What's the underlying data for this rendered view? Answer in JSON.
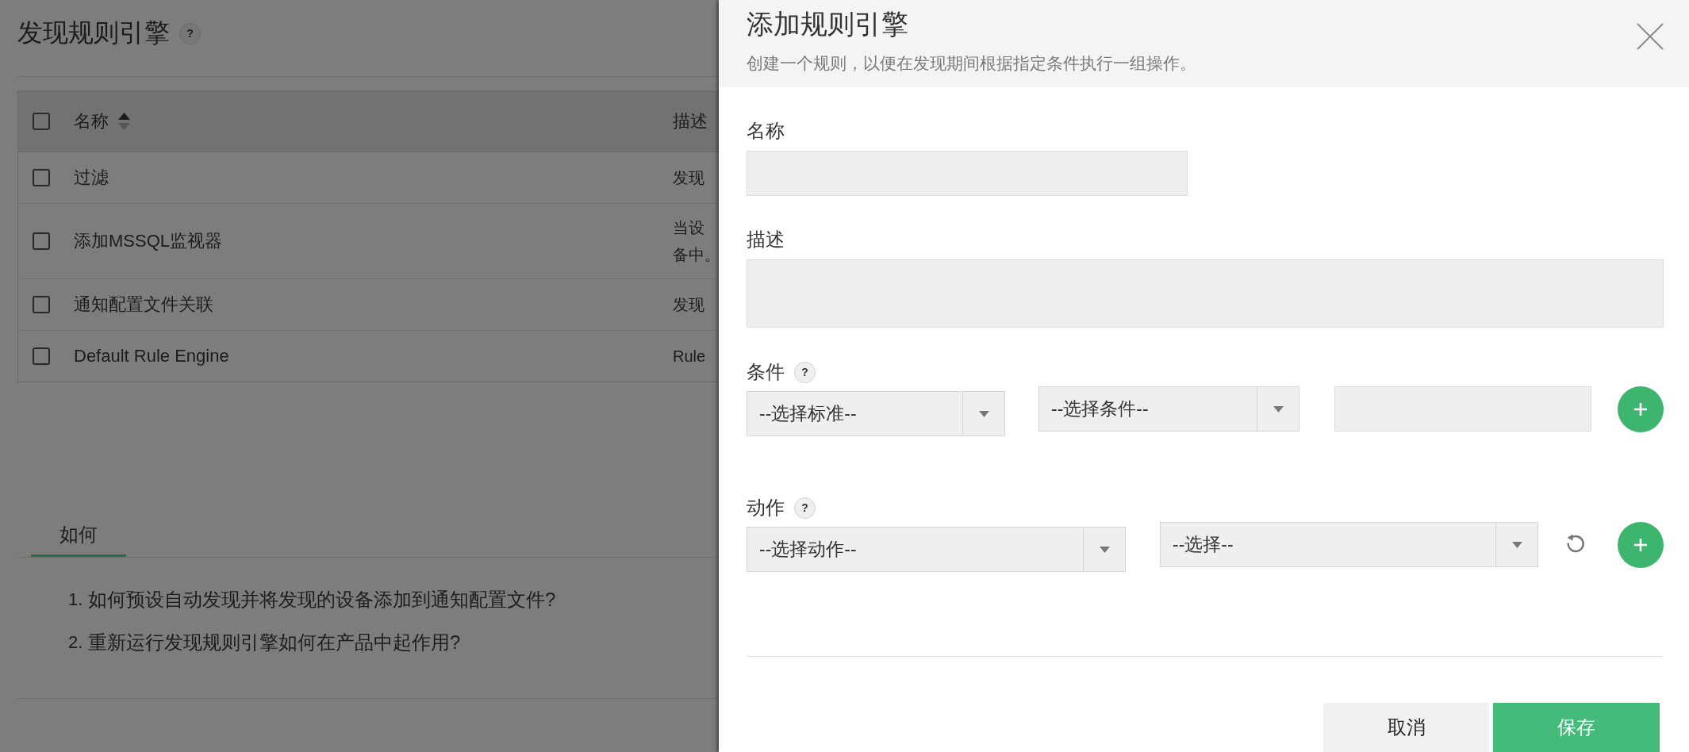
{
  "page": {
    "title": "发现规则引擎",
    "help": "?"
  },
  "table": {
    "all_checked": false,
    "columns": [
      {
        "label": "名称",
        "sortable": true
      },
      {
        "label": "描述",
        "sortable": false
      }
    ],
    "rows": [
      {
        "name": "过滤",
        "description": [
          "发现"
        ],
        "checked": false
      },
      {
        "name": "添加MSSQL监视器",
        "description": [
          "当设",
          "备中。"
        ],
        "checked": false
      },
      {
        "name": "通知配置文件关联",
        "description": [
          "发现"
        ],
        "checked": false
      },
      {
        "name": "Default Rule Engine",
        "description": [
          "Rule"
        ],
        "checked": false
      }
    ]
  },
  "howto": {
    "tabs": [
      {
        "label": "如何",
        "selected": true
      }
    ],
    "items": [
      {
        "number": "1.",
        "text": "如何预设自动发现并将发现的设备添加到通知配置文件?"
      },
      {
        "number": "2.",
        "text": "重新运行发现规则引擎如何在产品中起作用?"
      }
    ]
  },
  "panel": {
    "title": "添加规则引擎",
    "subtitle": "创建一个规则，以便在发现期间根据指定条件执行一组操作。",
    "fields": [
      {
        "label": "名称",
        "kind": "input"
      },
      {
        "label": "描述",
        "kind": "textarea"
      }
    ],
    "groups": [
      {
        "label": "条件",
        "help": "?",
        "controls": [
          {
            "kind": "select",
            "value": "--选择标准--"
          },
          {
            "kind": "select",
            "value": "--选择条件--"
          },
          {
            "kind": "input"
          },
          {
            "kind": "add"
          }
        ]
      },
      {
        "label": "动作",
        "help": "?",
        "controls": [
          {
            "kind": "select",
            "value": "--选择动作--"
          },
          {
            "kind": "select",
            "value": "--选择--"
          },
          {
            "kind": "reset"
          },
          {
            "kind": "add"
          }
        ]
      }
    ],
    "buttons": [
      {
        "label": "取消",
        "kind": "secondary"
      },
      {
        "label": "保存",
        "kind": "primary"
      }
    ]
  }
}
